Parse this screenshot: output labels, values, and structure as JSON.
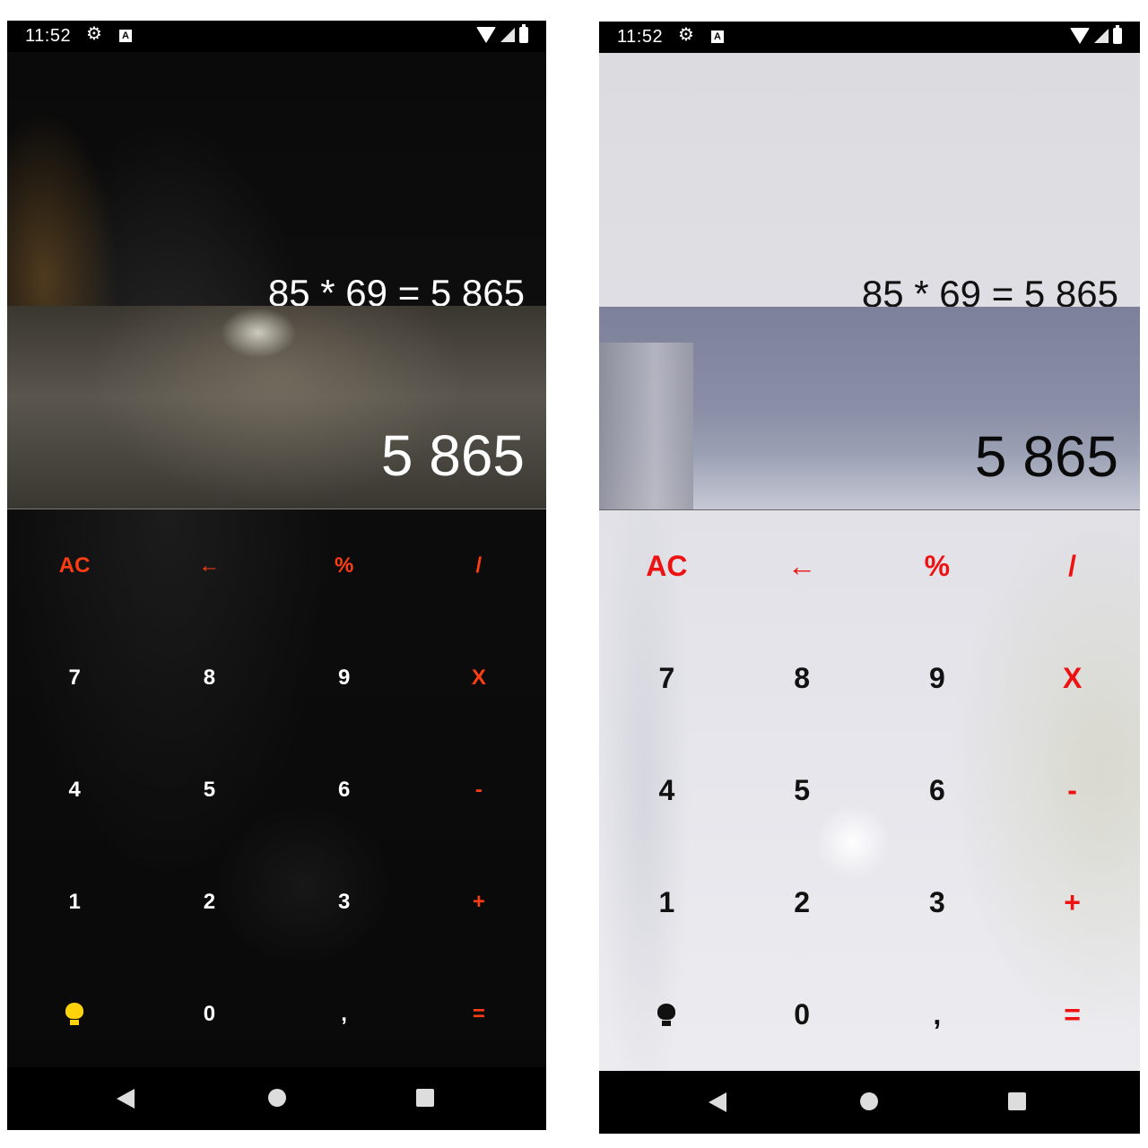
{
  "status_bar": {
    "time": "11:52",
    "a_badge": "A"
  },
  "display": {
    "expression": "85 * 69 = 5 865",
    "result": "5 865"
  },
  "keypad": {
    "row1": [
      "AC",
      "←",
      "%",
      "/"
    ],
    "row2": [
      "7",
      "8",
      "9",
      "X"
    ],
    "row3": [
      "4",
      "5",
      "6",
      "-"
    ],
    "row4": [
      "1",
      "2",
      "3",
      "+"
    ],
    "row5": [
      "0",
      ",",
      "="
    ]
  },
  "themes": {
    "dark": {
      "accent": "#ff3d12",
      "digit_color": "#ffffff",
      "theme_icon_color": "#ffd20a"
    },
    "light": {
      "accent": "#ee1111",
      "digit_color": "#111111",
      "theme_icon_color": "#111111"
    }
  },
  "icons": {
    "gear": "gear-icon",
    "wifi": "wifi-icon",
    "signal": "signal-icon",
    "battery": "battery-icon",
    "theme": "lightbulb-icon",
    "nav_back": "back-triangle-icon",
    "nav_home": "home-circle-icon",
    "nav_recent": "recent-square-icon"
  }
}
